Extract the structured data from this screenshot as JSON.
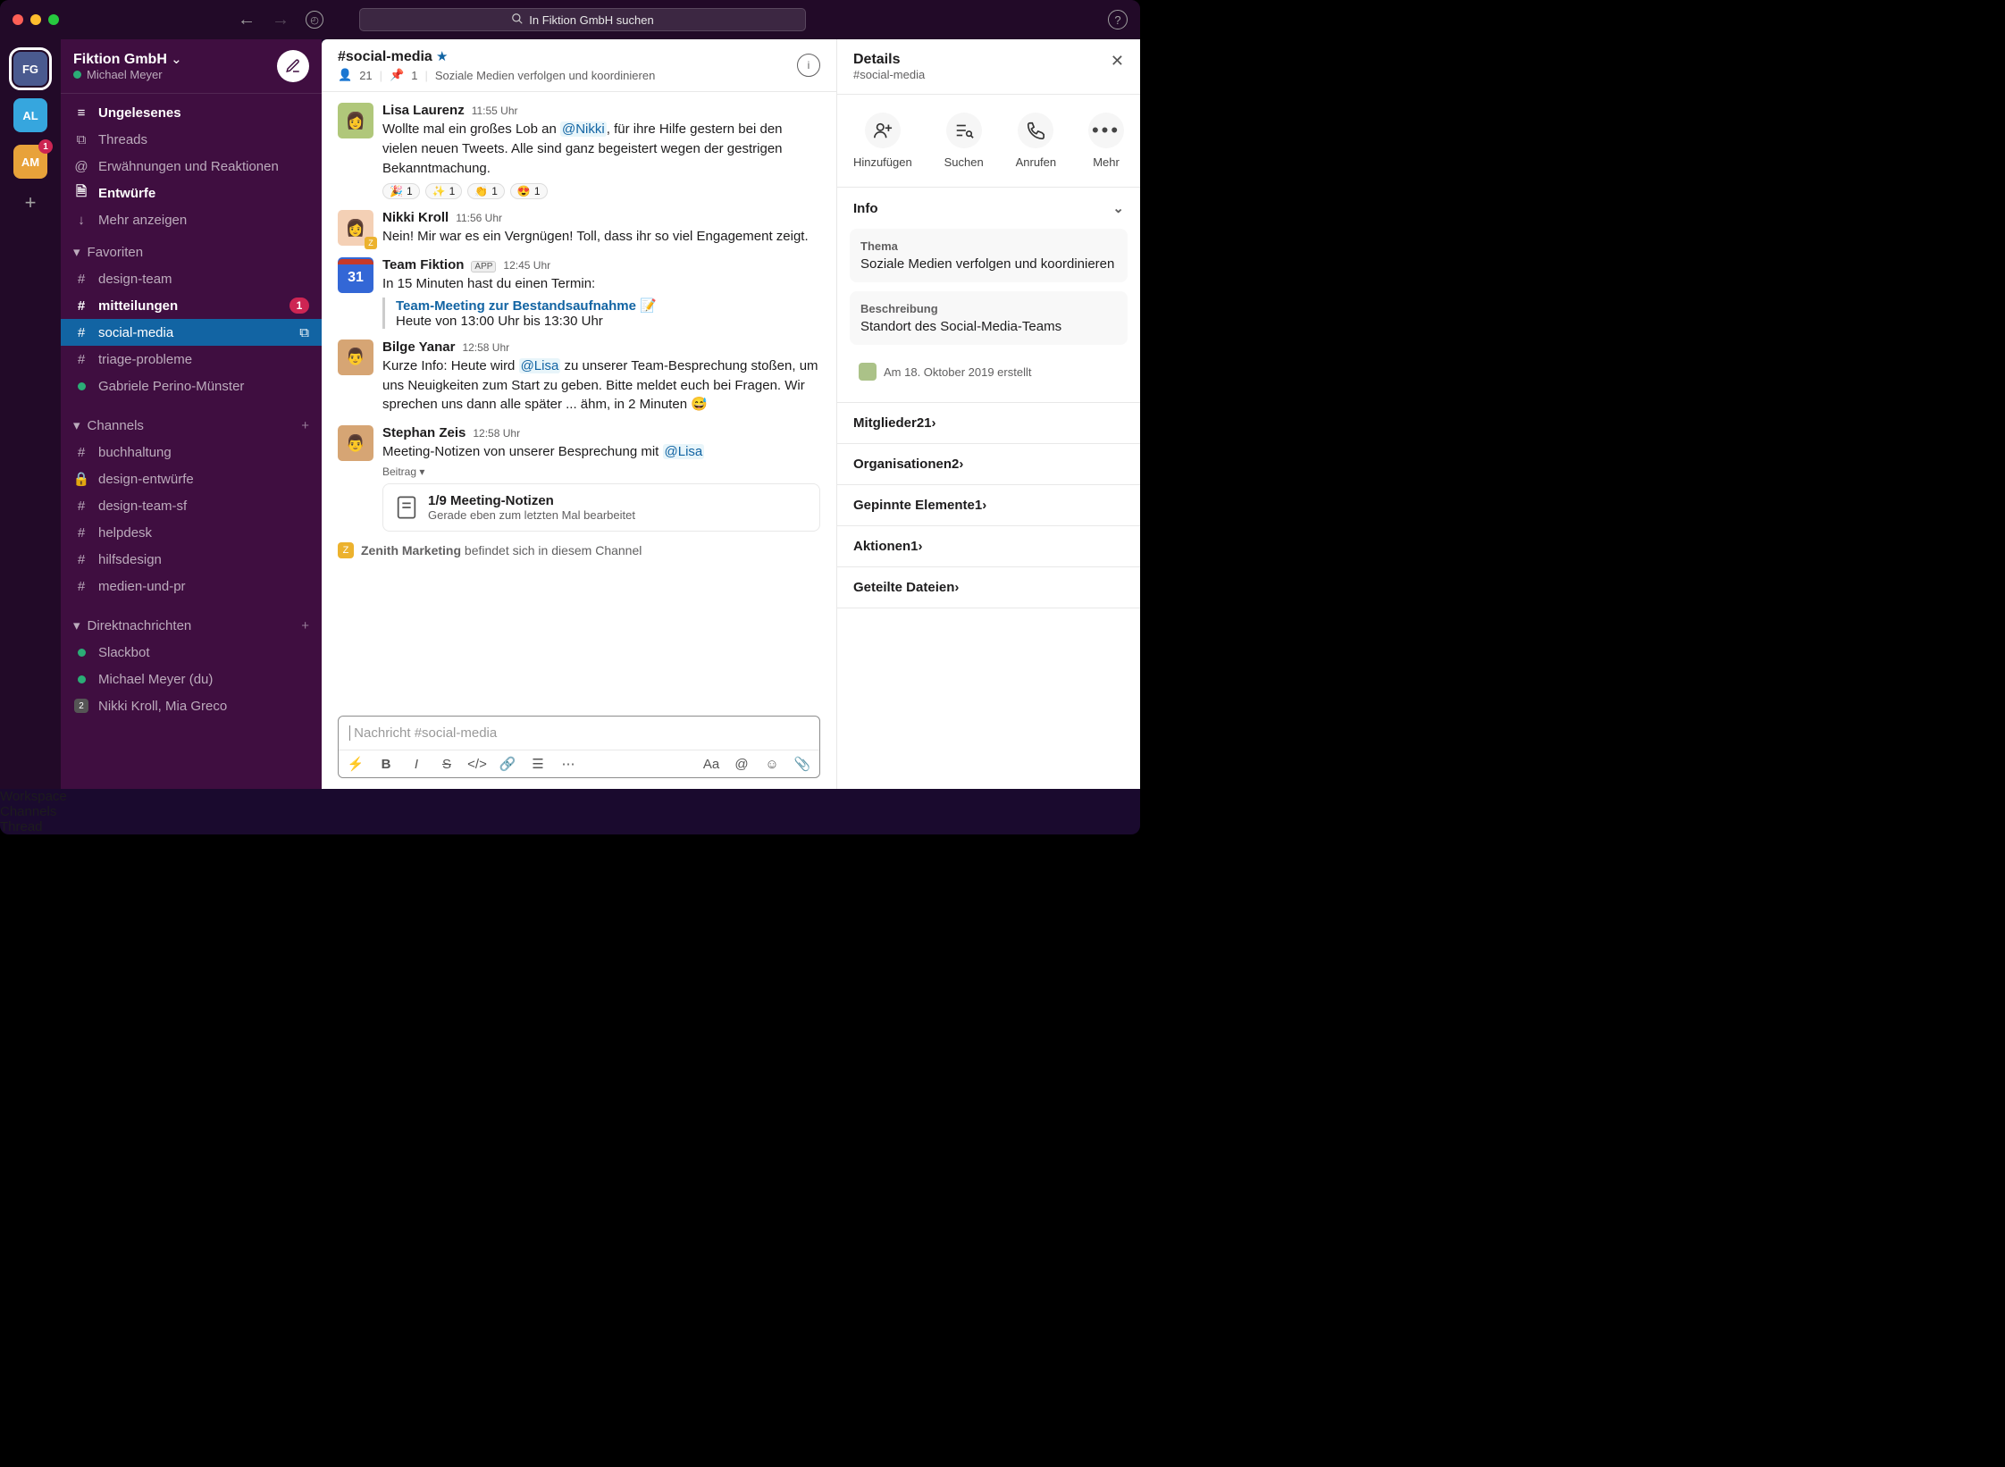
{
  "toolbar": {
    "search_placeholder": "In Fiktion GmbH suchen"
  },
  "workspaces": [
    {
      "abbr": "FG",
      "color": "#4a5a8f",
      "active": true
    },
    {
      "abbr": "AL",
      "color": "#36a6de"
    },
    {
      "abbr": "AM",
      "color": "#e8a23a",
      "badge": "1"
    }
  ],
  "sidebar": {
    "workspace_name": "Fiktion GmbH",
    "user_name": "Michael Meyer",
    "quick": [
      {
        "icon": "≡",
        "label": "Ungelesenes",
        "bold": true
      },
      {
        "icon": "⧉",
        "label": "Threads"
      },
      {
        "icon": "@",
        "label": "Erwähnungen und Reaktionen"
      },
      {
        "icon": "🗎",
        "label": "Entwürfe",
        "bold": true
      },
      {
        "icon": "↓",
        "label": "Mehr anzeigen"
      }
    ],
    "fav_header": "Favoriten",
    "favorites": [
      {
        "prefix": "#",
        "label": "design-team"
      },
      {
        "prefix": "#",
        "label": "mitteilungen",
        "bold": true,
        "badge": "1"
      },
      {
        "prefix": "#",
        "label": "social-media",
        "selected": true,
        "opp": true
      },
      {
        "prefix": "#",
        "label": "triage-probleme"
      },
      {
        "prefix": "●",
        "label": "Gabriele Perino-Münster"
      }
    ],
    "channels_header": "Channels",
    "channels": [
      {
        "prefix": "#",
        "label": "buchhaltung"
      },
      {
        "prefix": "🔒",
        "label": "design-entwürfe"
      },
      {
        "prefix": "#",
        "label": "design-team-sf"
      },
      {
        "prefix": "#",
        "label": "helpdesk"
      },
      {
        "prefix": "#",
        "label": "hilfsdesign"
      },
      {
        "prefix": "#",
        "label": "medien-und-pr"
      }
    ],
    "dm_header": "Direktnachrichten",
    "dms": [
      {
        "prefix": "●",
        "label": "Slackbot"
      },
      {
        "prefix": "●",
        "label": "Michael Meyer (du)"
      },
      {
        "prefix": "◧",
        "label": "Nikki Kroll, Mia Greco"
      }
    ]
  },
  "channel": {
    "name": "#social-media",
    "members": "21",
    "pins": "1",
    "topic": "Soziale Medien verfolgen und koordinieren"
  },
  "messages": [
    {
      "user": "Lisa Laurenz",
      "time": "11:55 Uhr",
      "avatar_color": "#b0c77a",
      "text_pre": "Wollte mal ein großes Lob an ",
      "mention": "@Nikki",
      "text_post": ", für ihre Hilfe gestern bei den vielen neuen Tweets. Alle sind ganz begeistert wegen der gestrigen Bekanntmachung.",
      "reactions": [
        {
          "emoji": "🎉",
          "count": "1"
        },
        {
          "emoji": "✨",
          "count": "1"
        },
        {
          "emoji": "👏",
          "count": "1"
        },
        {
          "emoji": "😍",
          "count": "1"
        }
      ]
    },
    {
      "user": "Nikki Kroll",
      "time": "11:56 Uhr",
      "avatar_color": "#f4d0b5",
      "corner": "Z",
      "text": "Nein! Mir war es ein Vergnügen! Toll, dass ihr so viel Engagement zeigt."
    },
    {
      "user": "Team Fiktion",
      "app": "APP",
      "time": "12:45 Uhr",
      "cal": "31",
      "text": "In 15 Minuten hast du einen Termin:",
      "event_title": "Team-Meeting zur Bestandsaufnahme 📝",
      "event_time": "Heute von 13:00 Uhr bis 13:30 Uhr"
    },
    {
      "user": "Bilge Yanar",
      "time": "12:58 Uhr",
      "avatar_color": "#d6a574",
      "text_pre": "Kurze Info: Heute wird ",
      "mention": "@Lisa",
      "text_post": " zu unserer Team-Besprechung stoßen, um uns Neuigkeiten zum Start zu geben. Bitte meldet euch bei Fragen. Wir sprechen uns dann alle später ... ähm, in 2 Minuten 😅"
    },
    {
      "user": "Stephan Zeis",
      "time": "12:58 Uhr",
      "avatar_color": "#d6a574",
      "text_pre": "Meeting-Notizen von unserer Besprechung mit ",
      "mention": "@Lisa",
      "post_label": "Beitrag ▾",
      "attach_title": "1/9 Meeting-Notizen",
      "attach_sub": "Gerade eben zum letzten Mal bearbeitet"
    }
  ],
  "channel_note": {
    "badge": "Z",
    "strong": "Zenith Marketing",
    "rest": " befindet sich in diesem Channel"
  },
  "composer": {
    "placeholder": "Nachricht #social-media"
  },
  "details": {
    "title": "Details",
    "channel": "#social-media",
    "actions": [
      {
        "label": "Hinzufügen",
        "glyph": "add-user-icon"
      },
      {
        "label": "Suchen",
        "glyph": "search-list-icon"
      },
      {
        "label": "Anrufen",
        "glyph": "phone-icon"
      },
      {
        "label": "Mehr",
        "glyph": "more-icon"
      }
    ],
    "info_header": "Info",
    "topic_label": "Thema",
    "topic_value": "Soziale Medien verfolgen und koordinieren",
    "desc_label": "Beschreibung",
    "desc_value": "Standort des Social-Media-Teams",
    "created": "Am 18. Oktober 2019 erstellt",
    "rows": [
      {
        "label": "Mitglieder",
        "partial": true,
        "count": "21"
      },
      {
        "label": "Organisationen",
        "count": "2",
        "pills": true
      },
      {
        "label": "Gepinnte Elemente",
        "count": "1"
      },
      {
        "label": "Aktionen",
        "count": "1"
      },
      {
        "label": "Geteilte Dateien"
      }
    ]
  },
  "annotations": {
    "workspace": "Workspace",
    "channels": "Channels",
    "thread": "Thread"
  }
}
